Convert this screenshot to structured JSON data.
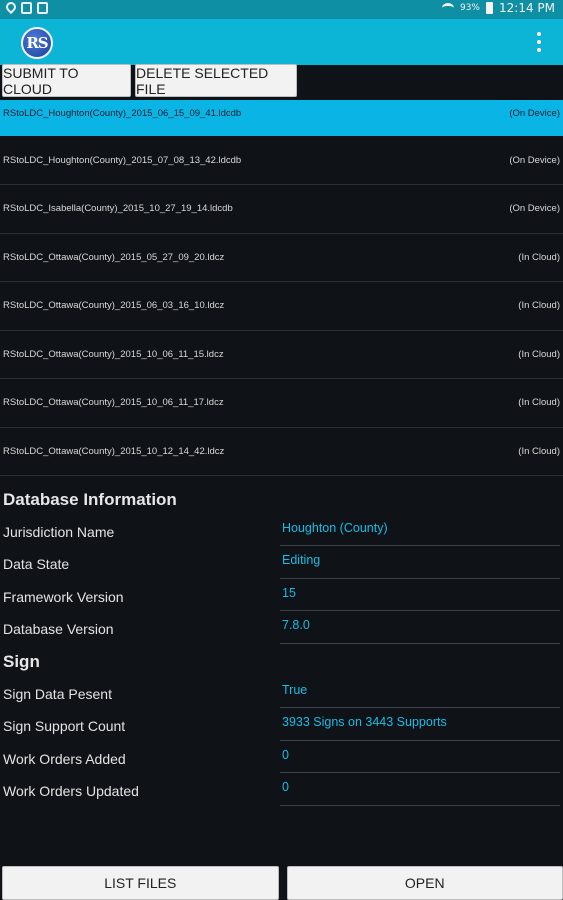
{
  "status_bar": {
    "battery": "93%",
    "time": "12:14 PM"
  },
  "app_bar": {
    "logo_text": "RS"
  },
  "actions": {
    "submit": "SUBMIT TO CLOUD",
    "delete": "DELETE SELECTED FILE"
  },
  "files": [
    {
      "name": "RStoLDC_Houghton(County)_2015_06_15_09_41.ldcdb",
      "status": "(On Device)",
      "selected": true
    },
    {
      "name": "RStoLDC_Houghton(County)_2015_07_08_13_42.ldcdb",
      "status": "(On Device)"
    },
    {
      "name": "RStoLDC_Isabella(County)_2015_10_27_19_14.ldcdb",
      "status": "(On Device)"
    },
    {
      "name": "RStoLDC_Ottawa(County)_2015_05_27_09_20.ldcz",
      "status": "(In Cloud)"
    },
    {
      "name": "RStoLDC_Ottawa(County)_2015_06_03_16_10.ldcz",
      "status": "(In Cloud)"
    },
    {
      "name": "RStoLDC_Ottawa(County)_2015_10_06_11_15.ldcz",
      "status": "(In Cloud)"
    },
    {
      "name": "RStoLDC_Ottawa(County)_2015_10_06_11_17.ldcz",
      "status": "(In Cloud)"
    },
    {
      "name": "RStoLDC_Ottawa(County)_2015_10_12_14_42.ldcz",
      "status": "(In Cloud)"
    }
  ],
  "database_info": {
    "title": "Database Information",
    "rows": [
      {
        "label": "Jurisdiction Name",
        "value": "Houghton (County)"
      },
      {
        "label": "Data State",
        "value": "Editing"
      },
      {
        "label": "Framework Version",
        "value": "15"
      },
      {
        "label": "Database Version",
        "value": "7.8.0"
      }
    ]
  },
  "sign": {
    "title": "Sign",
    "rows": [
      {
        "label": "Sign Data Pesent",
        "value": "True"
      },
      {
        "label": "Sign Support Count",
        "value": "3933 Signs on 3443 Supports"
      },
      {
        "label": "Work Orders Added",
        "value": "0"
      },
      {
        "label": "Work Orders Updated",
        "value": "0"
      }
    ]
  },
  "bottom": {
    "list_files": "LIST FILES",
    "open": "OPEN"
  }
}
